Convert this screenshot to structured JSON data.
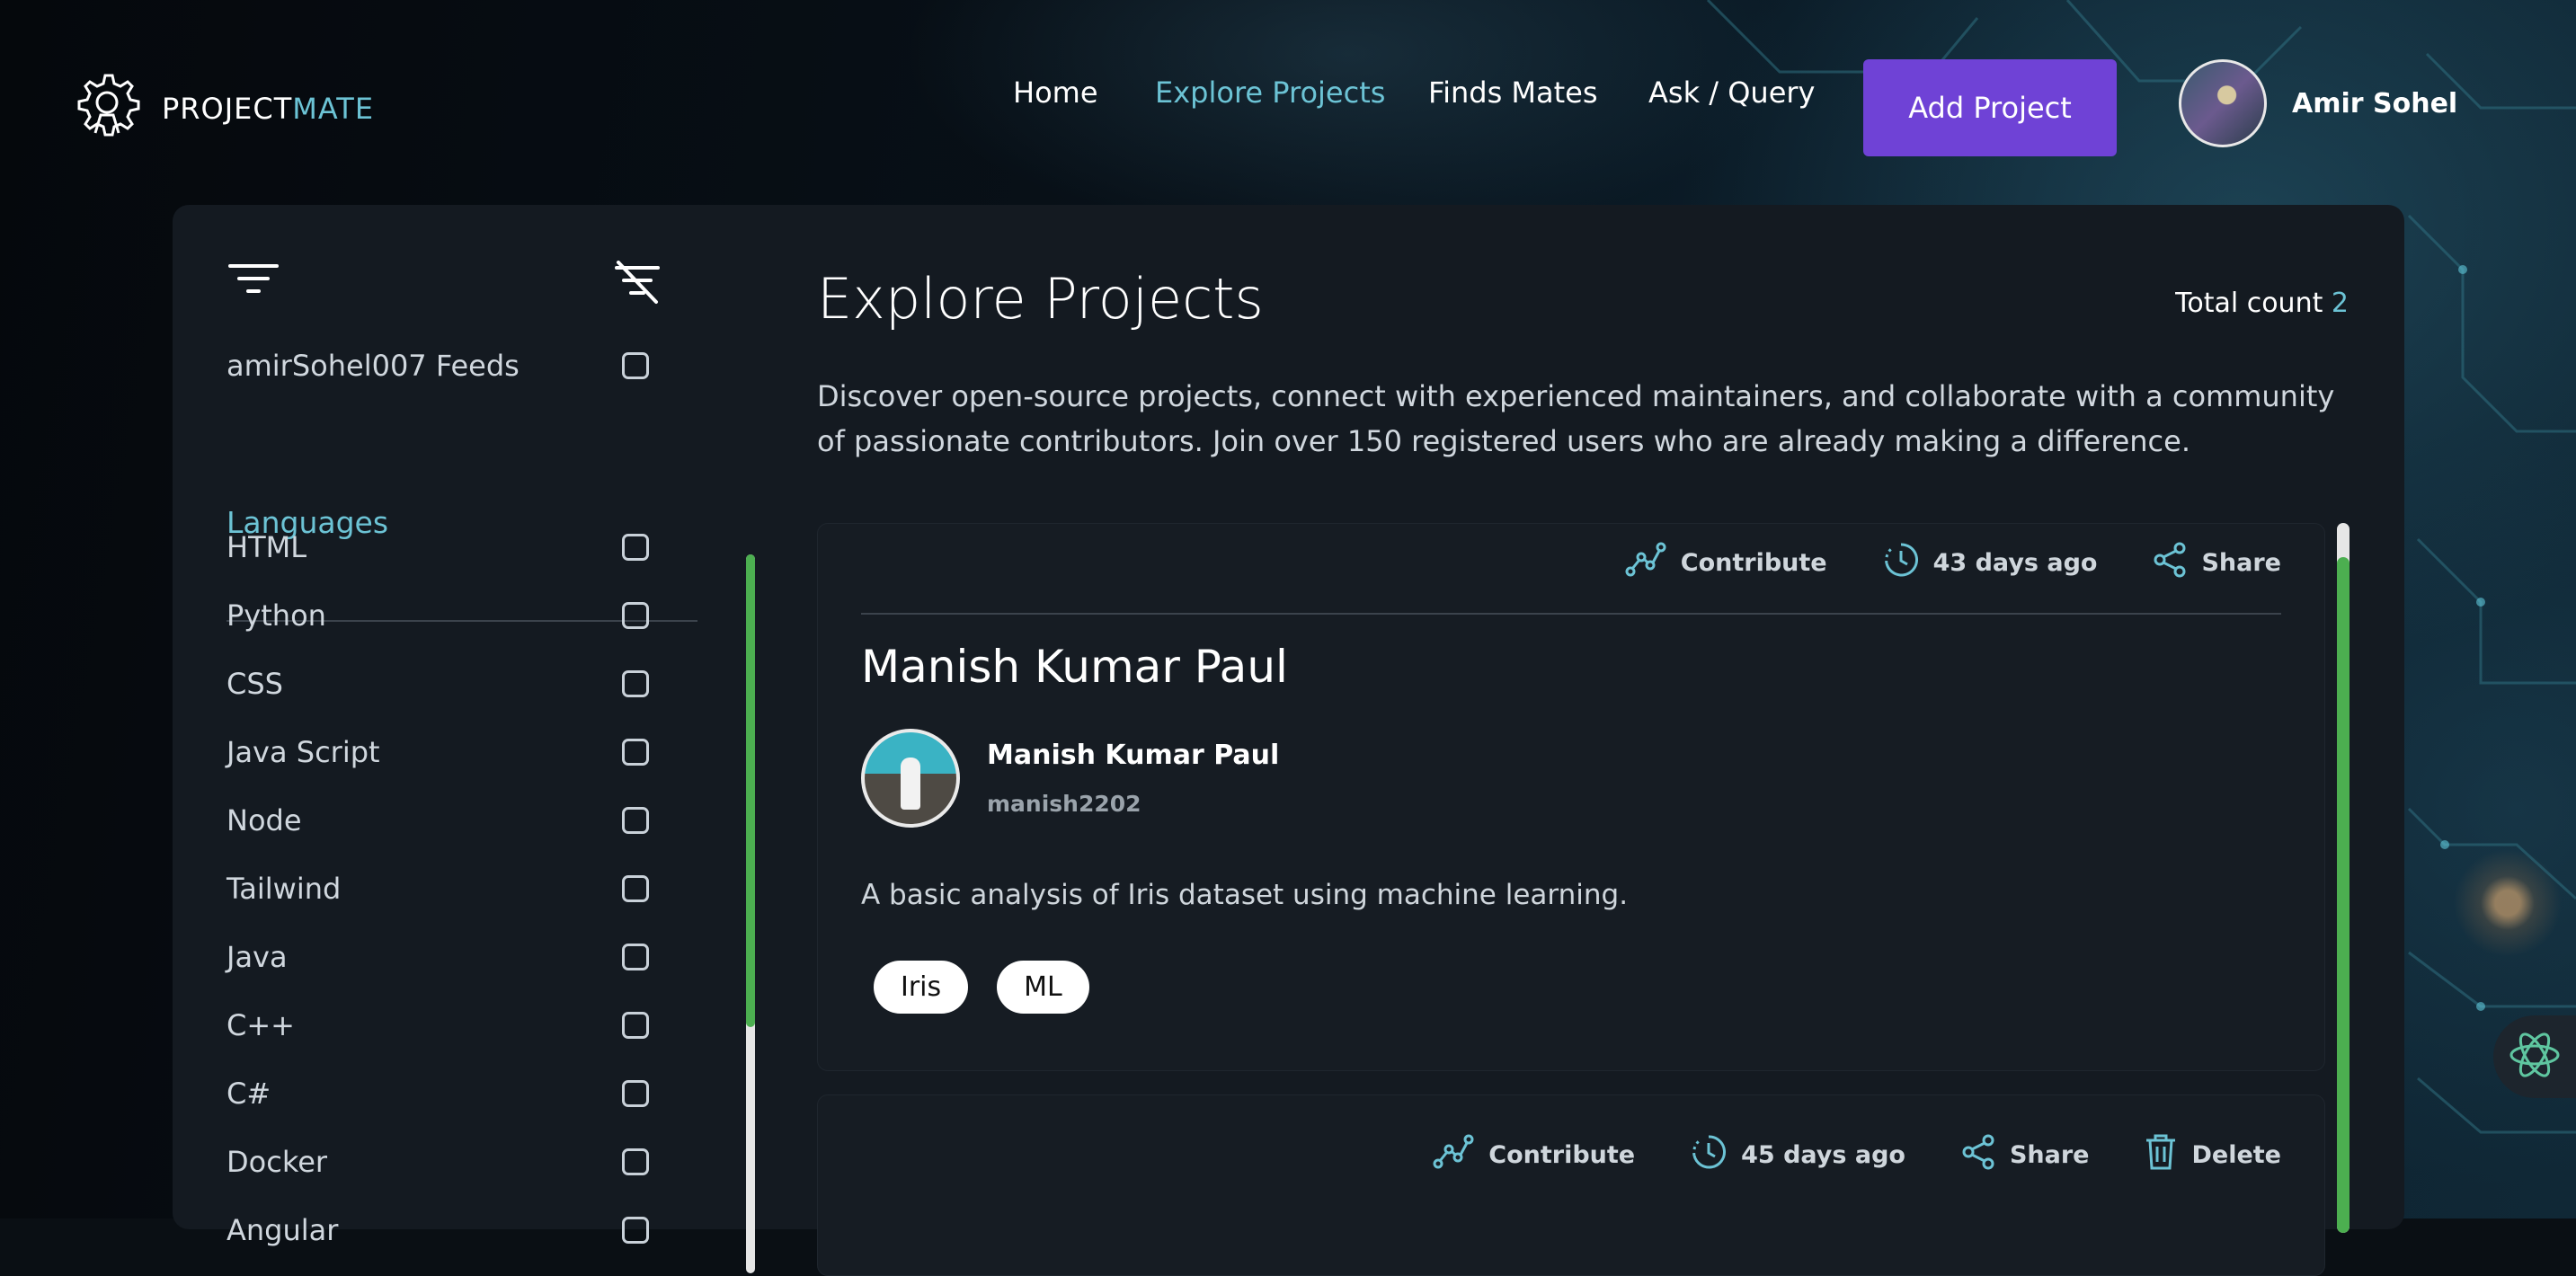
{
  "brand": {
    "part1": "PROJECT",
    "part2": "MATE"
  },
  "nav": {
    "home": "Home",
    "explore": "Explore Projects",
    "mates": "Finds Mates",
    "ask": "Ask / Query",
    "add_project": "Add Project"
  },
  "user": {
    "name": "Amir Sohel"
  },
  "sidebar": {
    "feeds_label": "amirSohel007 Feeds",
    "languages_title": "Languages",
    "languages": [
      "HTML",
      "Python",
      "CSS",
      "Java Script",
      "Node",
      "Tailwind",
      "Java",
      "C++",
      "C#",
      "Docker",
      "Angular"
    ]
  },
  "main": {
    "title": "Explore Projects",
    "total_label": "Total count",
    "total_value": "2",
    "description": "Discover open-source projects, connect with experienced maintainers, and collaborate with a community of passionate contributors. Join over 150 registered users who are already making a difference."
  },
  "cards": [
    {
      "contribute": "Contribute",
      "time": "43 days ago",
      "share": "Share",
      "title": "Manish Kumar Paul",
      "author_name": "Manish Kumar Paul",
      "author_handle": "manish2202",
      "description": "A basic analysis of Iris dataset using machine learning.",
      "tags": [
        "Iris",
        "ML"
      ]
    },
    {
      "contribute": "Contribute",
      "time": "45 days ago",
      "share": "Share",
      "delete": "Delete"
    }
  ],
  "colors": {
    "accent": "#6cc3d5",
    "button": "#6f42d6",
    "scroll": "#4caf50"
  }
}
